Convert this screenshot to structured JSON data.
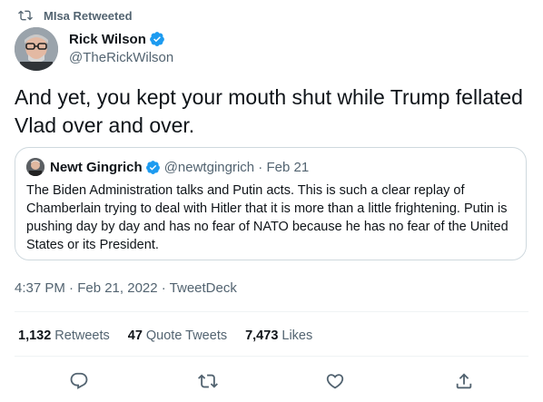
{
  "retweet_banner": {
    "icon": "retweet-icon",
    "text": "MIsa Retweeted"
  },
  "tweet": {
    "author": {
      "name": "Rick Wilson",
      "handle": "@TheRickWilson",
      "verified": true
    },
    "text": "And yet, you kept your mouth shut while Trump fellated Vlad over and over.",
    "timestamp": "4:37 PM · Feb 21, 2022 · TweetDeck",
    "quoted": {
      "author": {
        "name": "Newt Gingrich",
        "handle": "@newtgingrich",
        "date": "Feb 21",
        "verified": true
      },
      "text": "The Biden Administration talks and Putin acts. This is such a clear replay of Chamberlain trying to deal with Hitler that it is more than a little frightening. Putin is pushing day by day and has no fear of NATO because he has no fear of the United States or its President."
    }
  },
  "stats": {
    "retweets": {
      "count": "1,132",
      "label": "Retweets"
    },
    "quote_tweets": {
      "count": "47",
      "label": "Quote Tweets"
    },
    "likes": {
      "count": "7,473",
      "label": "Likes"
    }
  },
  "actions": [
    "reply-icon",
    "retweet-icon",
    "like-icon",
    "share-icon"
  ],
  "colors": {
    "verified": "#1d9bf0",
    "secondary_text": "#536471",
    "border": "#cfd9de"
  }
}
